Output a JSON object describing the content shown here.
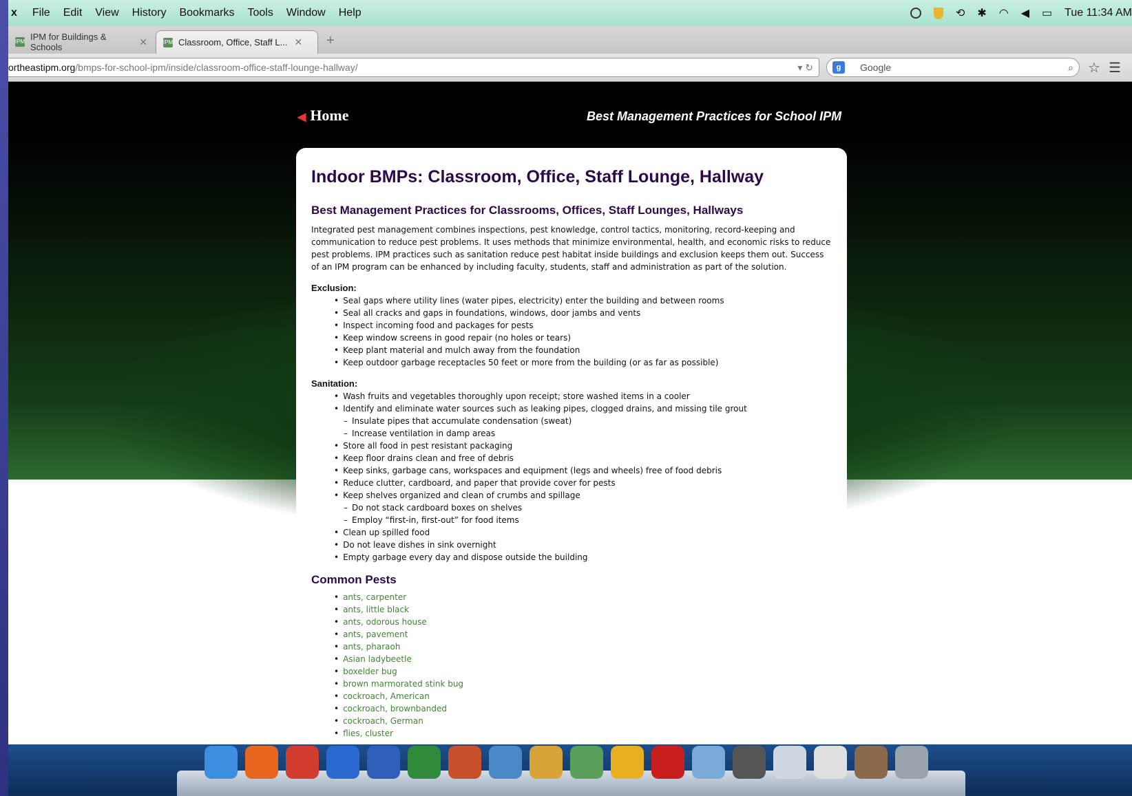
{
  "menubar": {
    "items": [
      "x",
      "File",
      "Edit",
      "View",
      "History",
      "Bookmarks",
      "Tools",
      "Window",
      "Help"
    ],
    "clock": "Tue 11:34 AM"
  },
  "tabs": [
    {
      "label": "IPM for Buildings & Schools",
      "icon": "ipm-favicon"
    },
    {
      "label": "Classroom, Office, Staff L...",
      "icon": "ipm-favicon"
    }
  ],
  "urlbar": {
    "host": "ortheastipm.org",
    "path": "/bmps-for-school-ipm/inside/classroom-office-staff-lounge-hallway/"
  },
  "search": {
    "placeholder": "Google"
  },
  "site": {
    "home_label": "Home",
    "tagline": "Best Management Practices for School IPM"
  },
  "article": {
    "title": "Indoor BMPs: Classroom, Office, Staff Lounge, Hallway",
    "section_title": "Best Management Practices for Classrooms, Offices, Staff Lounges, Hallways",
    "intro": "Integrated pest management combines inspections, pest knowledge, control tactics, monitoring, record-keeping and communication to reduce pest problems. It uses methods that minimize environmental, health, and economic risks to reduce pest problems. IPM practices such as sanitation reduce pest habitat inside buildings and exclusion keeps them out. Success of an IPM program can be enhanced by including faculty, students, staff and administration as part of the solution.",
    "exclusion_heading": "Exclusion:",
    "exclusion": [
      "Seal gaps where utility lines (water pipes, electricity) enter the building and between rooms",
      "Seal all cracks and gaps in foundations, windows, door jambs and vents",
      "Inspect incoming food and packages for pests",
      "Keep window screens in good repair (no holes or tears)",
      "Keep plant material and mulch away from the foundation",
      "Keep outdoor garbage receptacles 50 feet or more from the building (or as far as possible)"
    ],
    "sanitation_heading": "Sanitation:",
    "sanitation": [
      "Wash fruits and vegetables thoroughly upon receipt; store washed items in a cooler",
      "Identify and eliminate water sources such as leaking pipes, clogged drains, and missing tile grout",
      "Insulate pipes that accumulate condensation (sweat)",
      "Increase ventilation in damp areas",
      "Store all food in pest resistant packaging",
      "Keep floor drains clean and free of debris",
      "Keep sinks, garbage cans, workspaces and equipment (legs and wheels) free of food debris",
      "Reduce clutter, cardboard, and paper that provide cover for pests",
      "Keep shelves organized and clean of crumbs and spillage",
      "Do not stack cardboard boxes on shelves",
      "Employ “first-in, first-out” for food items",
      "Clean up spilled food",
      "Do not leave dishes in sink overnight",
      "Empty garbage every day and dispose outside the building"
    ],
    "pests_heading": "Common Pests",
    "pests": [
      "ants, carpenter",
      "ants, little black",
      "ants, odorous house",
      "ants, pavement",
      "ants, pharaoh",
      "Asian ladybeetle",
      "boxelder bug",
      "brown marmorated stink bug",
      "cockroach, American",
      "cockroach, brownbanded",
      "cockroach, German",
      "flies, cluster"
    ]
  },
  "dock": {
    "apps": [
      {
        "icon": "finder-icon",
        "color": "#3d8de0"
      },
      {
        "icon": "firefox-icon",
        "color": "#e8661e"
      },
      {
        "icon": "chrome-icon",
        "color": "#d23c2e"
      },
      {
        "icon": "google-earth-icon",
        "color": "#2a6ad0"
      },
      {
        "icon": "word-icon",
        "color": "#2f5fb8"
      },
      {
        "icon": "excel-icon",
        "color": "#2f8a3a"
      },
      {
        "icon": "powerpoint-icon",
        "color": "#c8502a"
      },
      {
        "icon": "preview-icon",
        "color": "#4a88c8"
      },
      {
        "icon": "photos-icon",
        "color": "#d8a43a"
      },
      {
        "icon": "network-icon",
        "color": "#5aa05a"
      },
      {
        "icon": "outlook-icon",
        "color": "#e8b020"
      },
      {
        "icon": "acrobat-icon",
        "color": "#c81e1e"
      },
      {
        "icon": "folder-icon",
        "color": "#7aaad8"
      },
      {
        "icon": "window-icon",
        "color": "#555555"
      },
      {
        "icon": "document-icon",
        "color": "#cfd8e0"
      },
      {
        "icon": "document-2-icon",
        "color": "#e0e0e0"
      },
      {
        "icon": "image-stack-icon",
        "color": "#8a6a4a"
      },
      {
        "icon": "trash-icon",
        "color": "#9aa4ae"
      }
    ]
  }
}
